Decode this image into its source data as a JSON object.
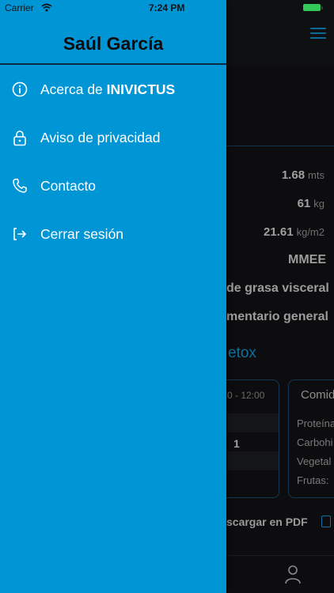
{
  "status_bar": {
    "carrier": "Carrier",
    "time": "7:24 PM"
  },
  "drawer": {
    "user_name": "Saúl García",
    "items": [
      {
        "label": "Acerca de ",
        "label_bold": "INIVICTUS",
        "icon": "info-icon"
      },
      {
        "label": "Aviso de privacidad",
        "icon": "lock-icon"
      },
      {
        "label": "Contacto",
        "icon": "phone-icon"
      },
      {
        "label": "Cerrar sesión",
        "icon": "logout-icon"
      }
    ]
  },
  "background": {
    "height": {
      "value": "1.68",
      "unit": "mts"
    },
    "weight": {
      "value": "61",
      "unit": "kg"
    },
    "imc": {
      "value": "21.61",
      "unit": "kg/m2"
    },
    "row_mmee": "MMEE",
    "row_grasa": "de grasa visceral",
    "row_plan": "mentario general",
    "link": "etox",
    "card1_time": "0 - 12:00",
    "card1_value": "1",
    "card2_title": "Comid",
    "card2_items": [
      "Proteína",
      "Carbohi",
      "Vegetal",
      "Frutas:"
    ],
    "pdf": "scargar en PDF"
  },
  "colors": {
    "drawer_bg": "#0096d6",
    "accent_dark": "#0f6f9f",
    "battery": "#34c759"
  }
}
